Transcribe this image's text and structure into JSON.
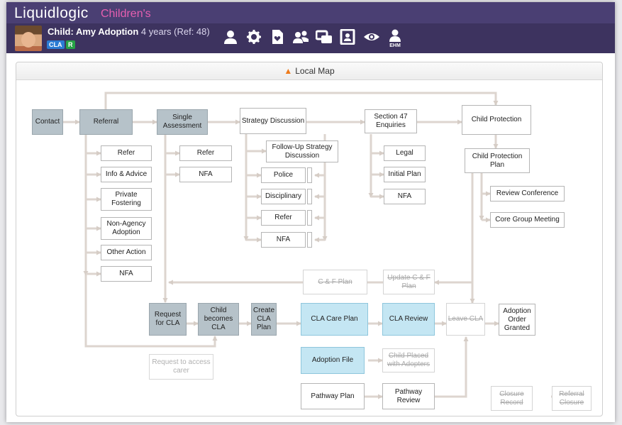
{
  "header": {
    "logo": "Liquidlogic",
    "app_name": "Children's",
    "child_name": "Child: Amy Adoption",
    "child_details": " 4 years (Ref: 48)",
    "badges": [
      "CLA",
      "R"
    ],
    "icons": [
      "person-icon",
      "gear-icon",
      "document-heart-icon",
      "group-icon",
      "windows-icon",
      "contact-card-icon",
      "eye-icon",
      "ehm-person-icon"
    ],
    "ehm_label": "EHM"
  },
  "panel": {
    "title": "Local Map"
  },
  "map": {
    "contact": "Contact",
    "referral": "Referral",
    "single_assessment": "Single Assessment",
    "strategy_discussion": "Strategy Discussion",
    "section47": "Section 47 Enquiries",
    "child_protection": "Child Protection",
    "cp_plan": "Child Protection Plan",
    "ref_refer": "Refer",
    "ref_info": "Info & Advice",
    "ref_private": "Private Fostering",
    "ref_nonagency": "Non-Agency Adoption",
    "ref_other": "Other Action",
    "ref_nfa": "NFA",
    "sa_refer": "Refer",
    "sa_nfa": "NFA",
    "followup": "Follow-Up Strategy Discussion",
    "police": "Police",
    "disciplinary": "Disciplinary",
    "sd_refer": "Refer",
    "sd_nfa": "NFA",
    "s47_legal": "Legal",
    "s47_initial": "Initial Plan",
    "s47_nfa": "NFA",
    "review_conference": "Review Conference",
    "core_group": "Core Group Meeting",
    "cf_plan": "C & F Plan",
    "update_cf": "Update C & F Plan",
    "request_cla": "Request for CLA",
    "child_becomes_cla": "Child becomes CLA",
    "create_cla_plan": "Create CLA Plan",
    "cla_care_plan": "CLA Care Plan",
    "cla_review": "CLA Review",
    "leave_cla": "Leave CLA",
    "adoption_order": "Adoption Order Granted",
    "request_carer": "Request to access carer",
    "adoption_file": "Adoption File",
    "child_placed": "Child Placed with Adopters",
    "pathway_plan": "Pathway Plan",
    "pathway_review": "Pathway Review",
    "closure_record": "Closure Record",
    "referral_closure": "Referral Closure"
  }
}
